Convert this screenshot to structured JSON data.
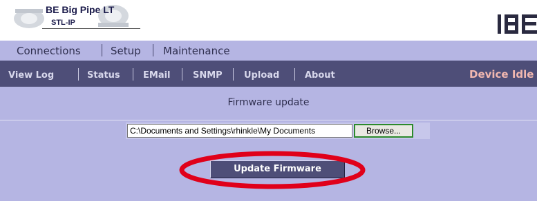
{
  "header": {
    "product_title": "BE Big Pipe LT",
    "product_sub": "STL-IP"
  },
  "menu_primary": {
    "items": [
      "Connections",
      "Setup",
      "Maintenance"
    ]
  },
  "menu_secondary": {
    "items": [
      "View Log",
      "Status",
      "EMail",
      "SNMP",
      "Upload",
      "About"
    ],
    "status": "Device Idle"
  },
  "section": {
    "title": "Firmware update"
  },
  "form": {
    "file_value": "C:\\Documents and Settings\\rhinkle\\My Documents",
    "browse_label": "Browse...",
    "update_label": "Update Firmware"
  },
  "colors": {
    "menu_light": "#b5b5e3",
    "menu_dark": "#4e4e78",
    "status_text": "#f2b8b0",
    "highlight": "#e0001a",
    "browse_border": "#2c8a2c"
  },
  "icons": {
    "logo": "equipment-logo-icon",
    "brand": "be-brand-icon"
  }
}
